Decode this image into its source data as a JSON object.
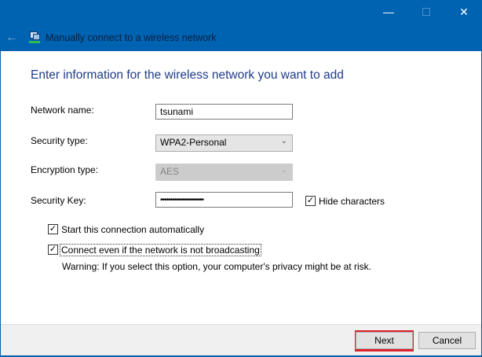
{
  "window": {
    "title": "Manually connect to a wireless network"
  },
  "heading": "Enter information for the wireless network you want to add",
  "form": {
    "network_name_label": "Network name:",
    "network_name_value": "tsunami",
    "security_type_label": "Security type:",
    "security_type_value": "WPA2-Personal",
    "encryption_type_label": "Encryption type:",
    "encryption_type_value": "AES",
    "security_key_label": "Security Key:",
    "security_key_value": "••••••••••••••••••••••",
    "hide_characters_label": "Hide characters",
    "hide_characters_checked": true,
    "start_auto_label": "Start this connection automatically",
    "start_auto_checked": true,
    "connect_broadcast_label": "Connect even if the network is not broadcasting",
    "connect_broadcast_checked": true,
    "warning": "Warning: If you select this option, your computer's privacy might be at risk."
  },
  "buttons": {
    "next": "Next",
    "cancel": "Cancel"
  },
  "colors": {
    "titlebar": "#0063b1",
    "highlight": "#e0202c"
  }
}
